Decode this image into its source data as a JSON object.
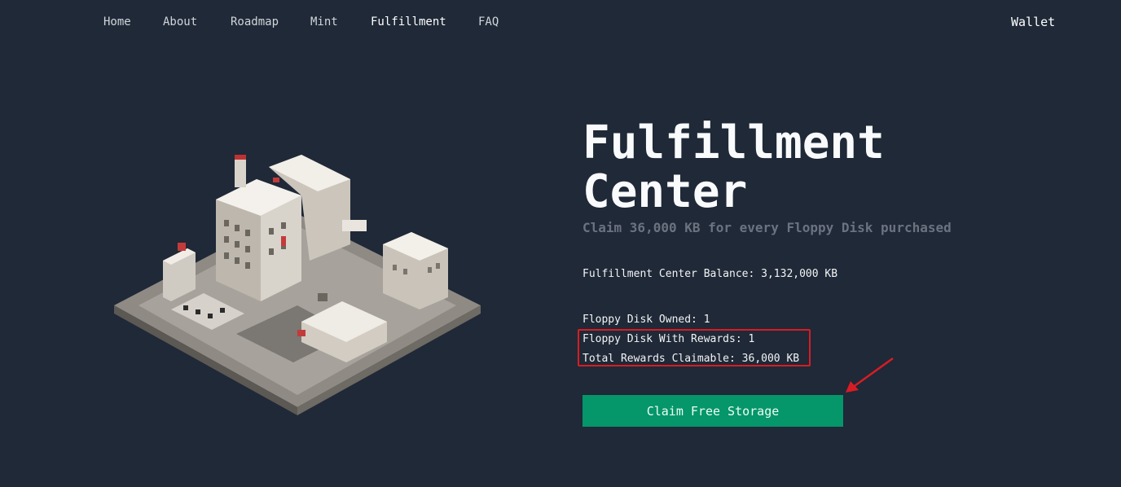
{
  "nav": {
    "items": [
      {
        "label": "Home"
      },
      {
        "label": "About"
      },
      {
        "label": "Roadmap"
      },
      {
        "label": "Mint"
      },
      {
        "label": "Fulfillment"
      },
      {
        "label": "FAQ"
      }
    ],
    "wallet_label": "Wallet"
  },
  "hero": {
    "title_line1": "Fulfillment",
    "title_line2": "Center",
    "subtitle": "Claim 36,000 KB for every Floppy Disk purchased"
  },
  "stats": {
    "balance": "Fulfillment Center Balance: 3,132,000 KB",
    "owned": "Floppy Disk Owned: 1",
    "with_rewards": "Floppy Disk With Rewards: 1",
    "claimable": "Total Rewards Claimable: 36,000 KB"
  },
  "actions": {
    "claim_label": "Claim Free Storage"
  },
  "colors": {
    "background": "#1f2937",
    "button": "#059669",
    "annotation": "#d91c24"
  }
}
